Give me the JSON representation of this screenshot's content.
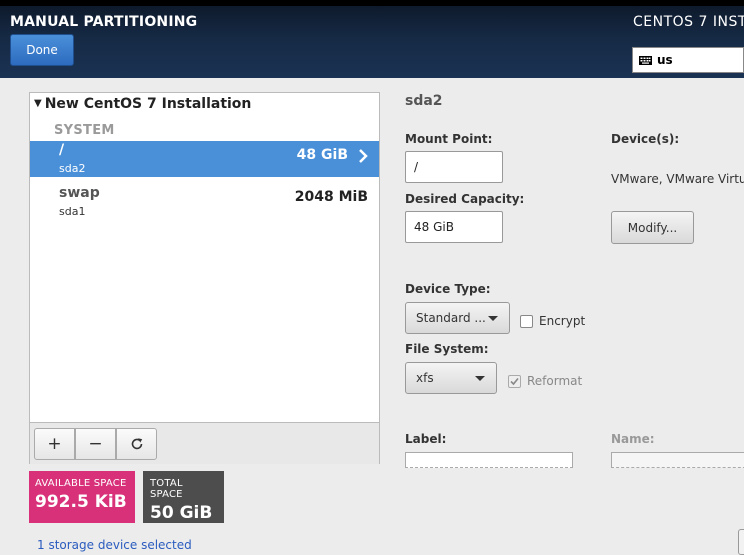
{
  "header": {
    "title": "MANUAL PARTITIONING",
    "product": "CENTOS 7 INST",
    "done_label": "Done",
    "keyboard_layout": "us"
  },
  "left_panel": {
    "install_title": "New CentOS 7 Installation",
    "group_label": "SYSTEM",
    "mount_points": [
      {
        "name": "/",
        "device": "sda2",
        "size": "48 GiB",
        "selected": true
      },
      {
        "name": "swap",
        "device": "sda1",
        "size": "2048 MiB",
        "selected": false
      }
    ],
    "toolbar": {
      "add": "+",
      "remove": "−",
      "refresh": "refresh-icon"
    }
  },
  "space": {
    "available_label": "AVAILABLE SPACE",
    "available_value": "992.5 KiB",
    "total_label": "TOTAL SPACE",
    "total_value": "50 GiB"
  },
  "storage_link": "1 storage device selected",
  "details": {
    "title": "sda2",
    "mount_point_label": "Mount Point:",
    "mount_point_value": "/",
    "capacity_label": "Desired Capacity:",
    "capacity_value": "48 GiB",
    "devices_label": "Device(s):",
    "devices_value": "VMware, VMware Virtu",
    "modify_label": "Modify...",
    "device_type_label": "Device Type:",
    "device_type_value": "Standard ...",
    "encrypt_label": "Encrypt",
    "encrypt_checked": false,
    "fs_label": "File System:",
    "fs_value": "xfs",
    "reformat_label": "Reformat",
    "reformat_checked": true,
    "label_label": "Label:",
    "name_label": "Name:"
  },
  "colors": {
    "selected_row": "#4a90d9",
    "available_bg": "#d8317a",
    "total_bg": "#4d4d4d",
    "header_bg": "#162a45"
  }
}
